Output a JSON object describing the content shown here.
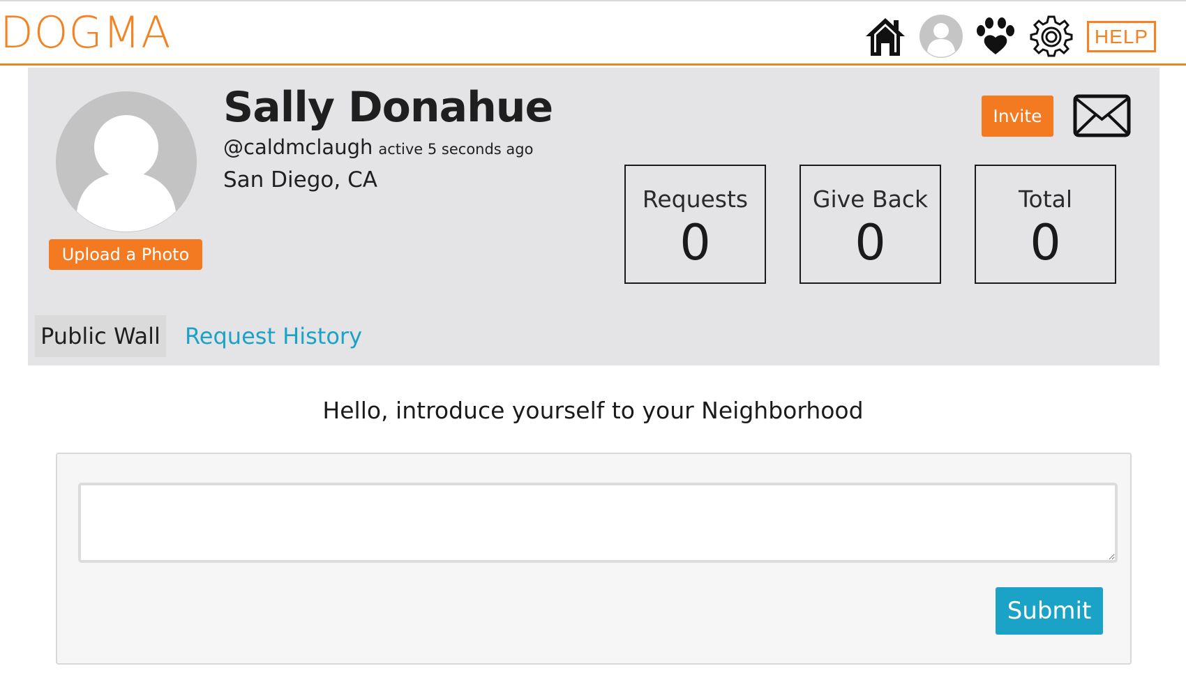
{
  "brand": {
    "logo_text": "DOGMA",
    "accent_color": "#f58220"
  },
  "nav": {
    "icons": [
      "home-icon",
      "profile-icon",
      "paw-icon",
      "gear-icon"
    ],
    "help_label": "HELP"
  },
  "profile": {
    "name": "Sally Donahue",
    "handle": "@caldmclaugh",
    "activity": "active 5 seconds ago",
    "location": "San Diego, CA",
    "upload_label": "Upload a Photo",
    "invite_label": "Invite"
  },
  "stats": [
    {
      "label": "Requests",
      "value": "0"
    },
    {
      "label": "Give Back",
      "value": "0"
    },
    {
      "label": "Total",
      "value": "0"
    }
  ],
  "tabs": [
    {
      "label": "Public Wall",
      "active": true
    },
    {
      "label": "Request History",
      "active": false
    }
  ],
  "wall": {
    "intro": "Hello, introduce yourself to your Neighborhood",
    "post_value": "",
    "submit_label": "Submit",
    "submit_color": "#1aa3c7"
  }
}
